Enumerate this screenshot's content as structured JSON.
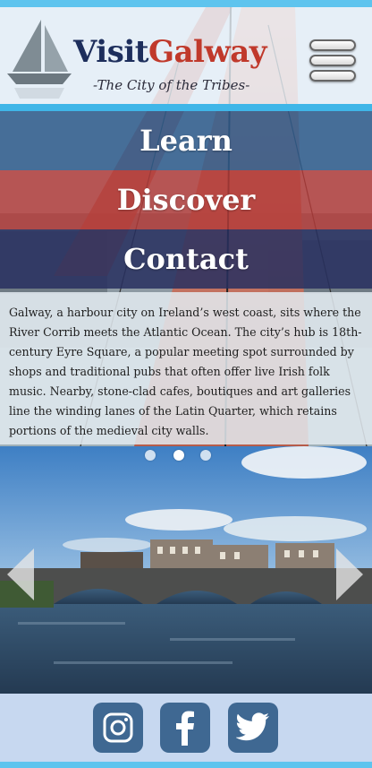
{
  "header": {
    "brand_first": "Visit",
    "brand_second": "Galway",
    "tagline": "-The City of the Tribes-",
    "menu_icon": "hamburger-icon",
    "logo_icon": "sailboat-logo"
  },
  "nav": {
    "items": [
      {
        "label": "Learn"
      },
      {
        "label": "Discover"
      },
      {
        "label": "Contact"
      }
    ]
  },
  "intro": {
    "text": "Galway, a harbour city on Ireland’s west coast, sits where the River Corrib meets the Atlantic Ocean. The city’s hub is 18th-century Eyre Square, a popular meeting spot surrounded by shops and traditional pubs that often offer live Irish folk music. Nearby, stone-clad cafes, boutiques and art galleries line the winding lanes of the Latin Quarter, which retains portions of the medieval city walls."
  },
  "carousel": {
    "slide_count": 3,
    "active_slide": 2,
    "prev_icon": "chevron-left-icon",
    "next_icon": "chevron-right-icon"
  },
  "footer": {
    "social": [
      {
        "name": "instagram",
        "icon": "instagram-icon"
      },
      {
        "name": "facebook",
        "icon": "facebook-icon"
      },
      {
        "name": "twitter",
        "icon": "twitter-icon"
      }
    ]
  },
  "colors": {
    "brand_navy": "#1d2e5c",
    "brand_red": "#c0392b",
    "learn_band": "#305c8c",
    "discover_band": "#b23a38",
    "contact_band": "#283060",
    "accent_cyan": "#3fb6e8",
    "social_button": "#3f6892"
  }
}
